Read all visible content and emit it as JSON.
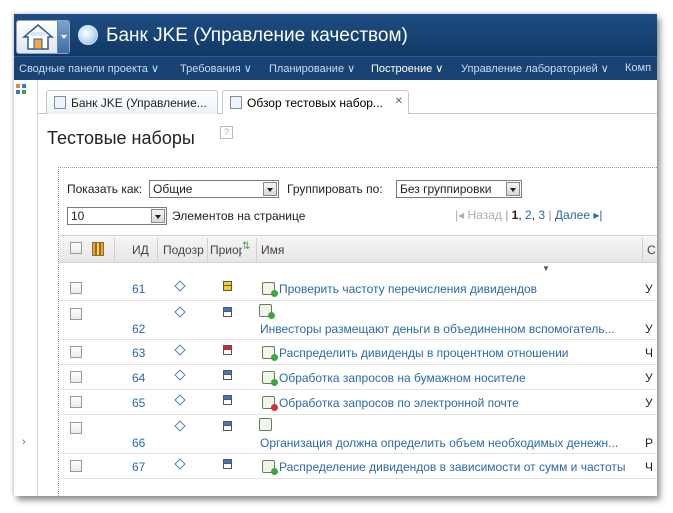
{
  "app": {
    "title": "Банк JKE (Управление качеством)"
  },
  "nav": {
    "items": [
      {
        "label": "Сводные панели проекта ∨",
        "active": false
      },
      {
        "label": "Требования ∨",
        "active": false
      },
      {
        "label": "Планирование ∨",
        "active": false
      },
      {
        "label": "Построение ∨",
        "active": true
      },
      {
        "label": "Управление лабораторией ∨",
        "active": false
      },
      {
        "label": "Комп",
        "active": false
      }
    ]
  },
  "tabs": [
    {
      "label": "Банк JKE (Управление...",
      "active": false
    },
    {
      "label": "Обзор тестовых набор...",
      "active": true
    }
  ],
  "page": {
    "title": "Тестовые наборы",
    "help": "?"
  },
  "filters": {
    "show_as_label": "Показать как:",
    "show_as_value": "Общие",
    "group_by_label": "Группировать по:",
    "group_by_value": "Без группировки",
    "per_page_value": "10",
    "per_page_label": "Элементов на странице"
  },
  "pager": {
    "prev": "Назад",
    "current": "1",
    "pages": [
      "2",
      "3"
    ],
    "next": "Далее"
  },
  "columns": {
    "id": "ИД",
    "suspect": "Подозр",
    "priority": "Приор",
    "name": "Имя",
    "last": "С"
  },
  "colors": {
    "priority_yellow": "#f3d11a",
    "priority_blue": "#3d79c9",
    "priority_red": "#e02020",
    "status_green": "#3aa83a",
    "status_red": "#d83030"
  },
  "rows": [
    {
      "id": "61",
      "name": "Проверить частоту перечисления дивидендов",
      "last": "У",
      "priority": "yellow",
      "status": "green",
      "tall": false
    },
    {
      "id": "62",
      "name": "Инвесторы размещают деньги в объединенном вспомогатель...",
      "last": "У",
      "priority": "blue",
      "status": "green",
      "tall": true
    },
    {
      "id": "63",
      "name": "Распределить дивиденды в процентном отношении",
      "last": "Ч",
      "priority": "red",
      "status": "green",
      "tall": false
    },
    {
      "id": "64",
      "name": "Обработка запросов на бумажном носителе",
      "last": "У",
      "priority": "blue",
      "status": "green",
      "tall": false
    },
    {
      "id": "65",
      "name": "Обработка запросов по электронной почте",
      "last": "У",
      "priority": "blue",
      "status": "red",
      "tall": false
    },
    {
      "id": "66",
      "name": "Организация должна определить объем необходимых денежн...",
      "last": "Р",
      "priority": "blue",
      "status": "none",
      "tall": true
    },
    {
      "id": "67",
      "name": "Распределение дивидендов в зависимости от сумм и частоты",
      "last": "Ч",
      "priority": "blue",
      "status": "green",
      "tall": false
    }
  ]
}
